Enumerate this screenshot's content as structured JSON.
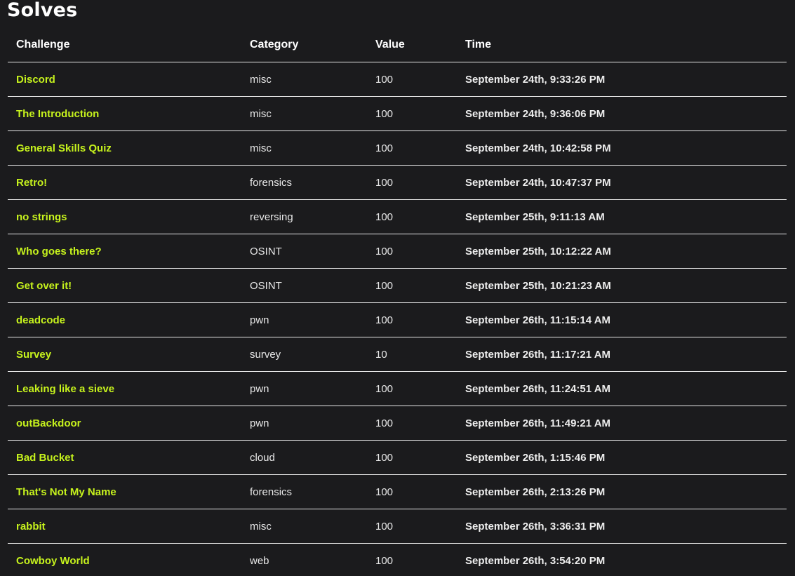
{
  "page": {
    "title": "Solves"
  },
  "table": {
    "headers": {
      "challenge": "Challenge",
      "category": "Category",
      "value": "Value",
      "time": "Time"
    },
    "rows": [
      {
        "challenge": "Discord",
        "category": "misc",
        "value": "100",
        "time": "September 24th, 9:33:26 PM"
      },
      {
        "challenge": "The Introduction",
        "category": "misc",
        "value": "100",
        "time": "September 24th, 9:36:06 PM"
      },
      {
        "challenge": "General Skills Quiz",
        "category": "misc",
        "value": "100",
        "time": "September 24th, 10:42:58 PM"
      },
      {
        "challenge": "Retro!",
        "category": "forensics",
        "value": "100",
        "time": "September 24th, 10:47:37 PM"
      },
      {
        "challenge": "no strings",
        "category": "reversing",
        "value": "100",
        "time": "September 25th, 9:11:13 AM"
      },
      {
        "challenge": "Who goes there?",
        "category": "OSINT",
        "value": "100",
        "time": "September 25th, 10:12:22 AM"
      },
      {
        "challenge": "Get over it!",
        "category": "OSINT",
        "value": "100",
        "time": "September 25th, 10:21:23 AM"
      },
      {
        "challenge": "deadcode",
        "category": "pwn",
        "value": "100",
        "time": "September 26th, 11:15:14 AM"
      },
      {
        "challenge": "Survey",
        "category": "survey",
        "value": "10",
        "time": "September 26th, 11:17:21 AM"
      },
      {
        "challenge": "Leaking like a sieve",
        "category": "pwn",
        "value": "100",
        "time": "September 26th, 11:24:51 AM"
      },
      {
        "challenge": "outBackdoor",
        "category": "pwn",
        "value": "100",
        "time": "September 26th, 11:49:21 AM"
      },
      {
        "challenge": "Bad Bucket",
        "category": "cloud",
        "value": "100",
        "time": "September 26th, 1:15:46 PM"
      },
      {
        "challenge": "That's Not My Name",
        "category": "forensics",
        "value": "100",
        "time": "September 26th, 2:13:26 PM"
      },
      {
        "challenge": "rabbit",
        "category": "misc",
        "value": "100",
        "time": "September 26th, 3:36:31 PM"
      },
      {
        "challenge": "Cowboy World",
        "category": "web",
        "value": "100",
        "time": "September 26th, 3:54:20 PM"
      }
    ]
  },
  "colors": {
    "background": "#1b1b1d",
    "accent": "#c6f21d",
    "text": "#ffffff",
    "divider": "#e8e8e8"
  }
}
